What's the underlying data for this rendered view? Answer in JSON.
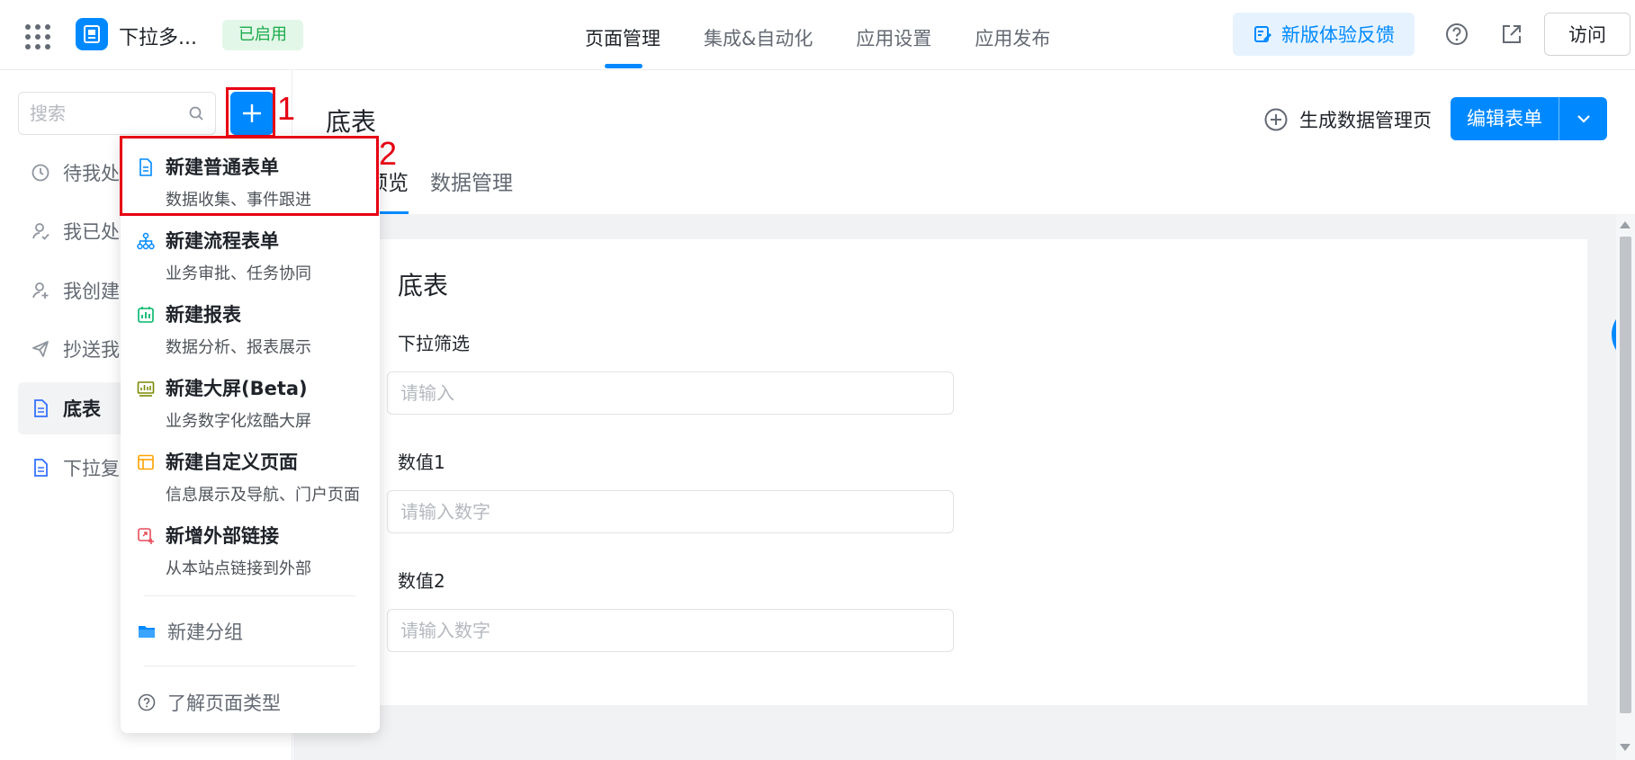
{
  "header": {
    "app_name": "下拉多...",
    "status_badge": "已启用",
    "nav_tabs": [
      {
        "label": "页面管理",
        "active": true
      },
      {
        "label": "集成&自动化",
        "active": false
      },
      {
        "label": "应用设置",
        "active": false
      },
      {
        "label": "应用发布",
        "active": false
      }
    ],
    "feedback_label": "新版体验反馈",
    "visit_label": "访问"
  },
  "sidebar": {
    "search_placeholder": "搜索",
    "items": [
      {
        "label": "待我处理",
        "icon": "clock-icon"
      },
      {
        "label": "我已处理",
        "icon": "user-check-icon"
      },
      {
        "label": "我创建的",
        "icon": "user-add-icon"
      },
      {
        "label": "抄送我的",
        "icon": "send-icon"
      },
      {
        "label": "底表",
        "icon": "document-icon",
        "active": true
      },
      {
        "label": "下拉复选",
        "icon": "document-icon"
      }
    ]
  },
  "main": {
    "title": "底表",
    "generate_label": "生成数据管理页",
    "edit_label": "编辑表单",
    "subtabs": [
      {
        "label": "表单预览",
        "active": true
      },
      {
        "label": "数据管理",
        "active": false
      }
    ],
    "form": {
      "title": "底表",
      "fields": [
        {
          "label": "下拉筛选",
          "placeholder": "请输入"
        },
        {
          "label": "数值1",
          "placeholder": "请输入数字"
        },
        {
          "label": "数值2",
          "placeholder": "请输入数字"
        }
      ]
    }
  },
  "menu": {
    "items": [
      {
        "title": "新建普通表单",
        "desc": "数据收集、事件跟进",
        "icon": "form-icon",
        "color": "#0089ff"
      },
      {
        "title": "新建流程表单",
        "desc": "业务审批、任务协同",
        "icon": "flow-icon",
        "color": "#0089ff"
      },
      {
        "title": "新建报表",
        "desc": "数据分析、报表展示",
        "icon": "report-icon",
        "color": "#00b86b"
      },
      {
        "title": "新建大屏(Beta)",
        "desc": "业务数字化炫酷大屏",
        "icon": "screen-icon",
        "color": "#7a8a00"
      },
      {
        "title": "新建自定义页面",
        "desc": "信息展示及导航、门户页面",
        "icon": "custom-page-icon",
        "color": "#ffa200"
      },
      {
        "title": "新增外部链接",
        "desc": "从本站点链接到外部",
        "icon": "external-link-icon",
        "color": "#e94b5a"
      }
    ],
    "new_group_label": "新建分组",
    "page_types_label": "了解页面类型"
  },
  "annotations": {
    "label_1": "1",
    "label_2": "2",
    "color": "#e60012"
  }
}
